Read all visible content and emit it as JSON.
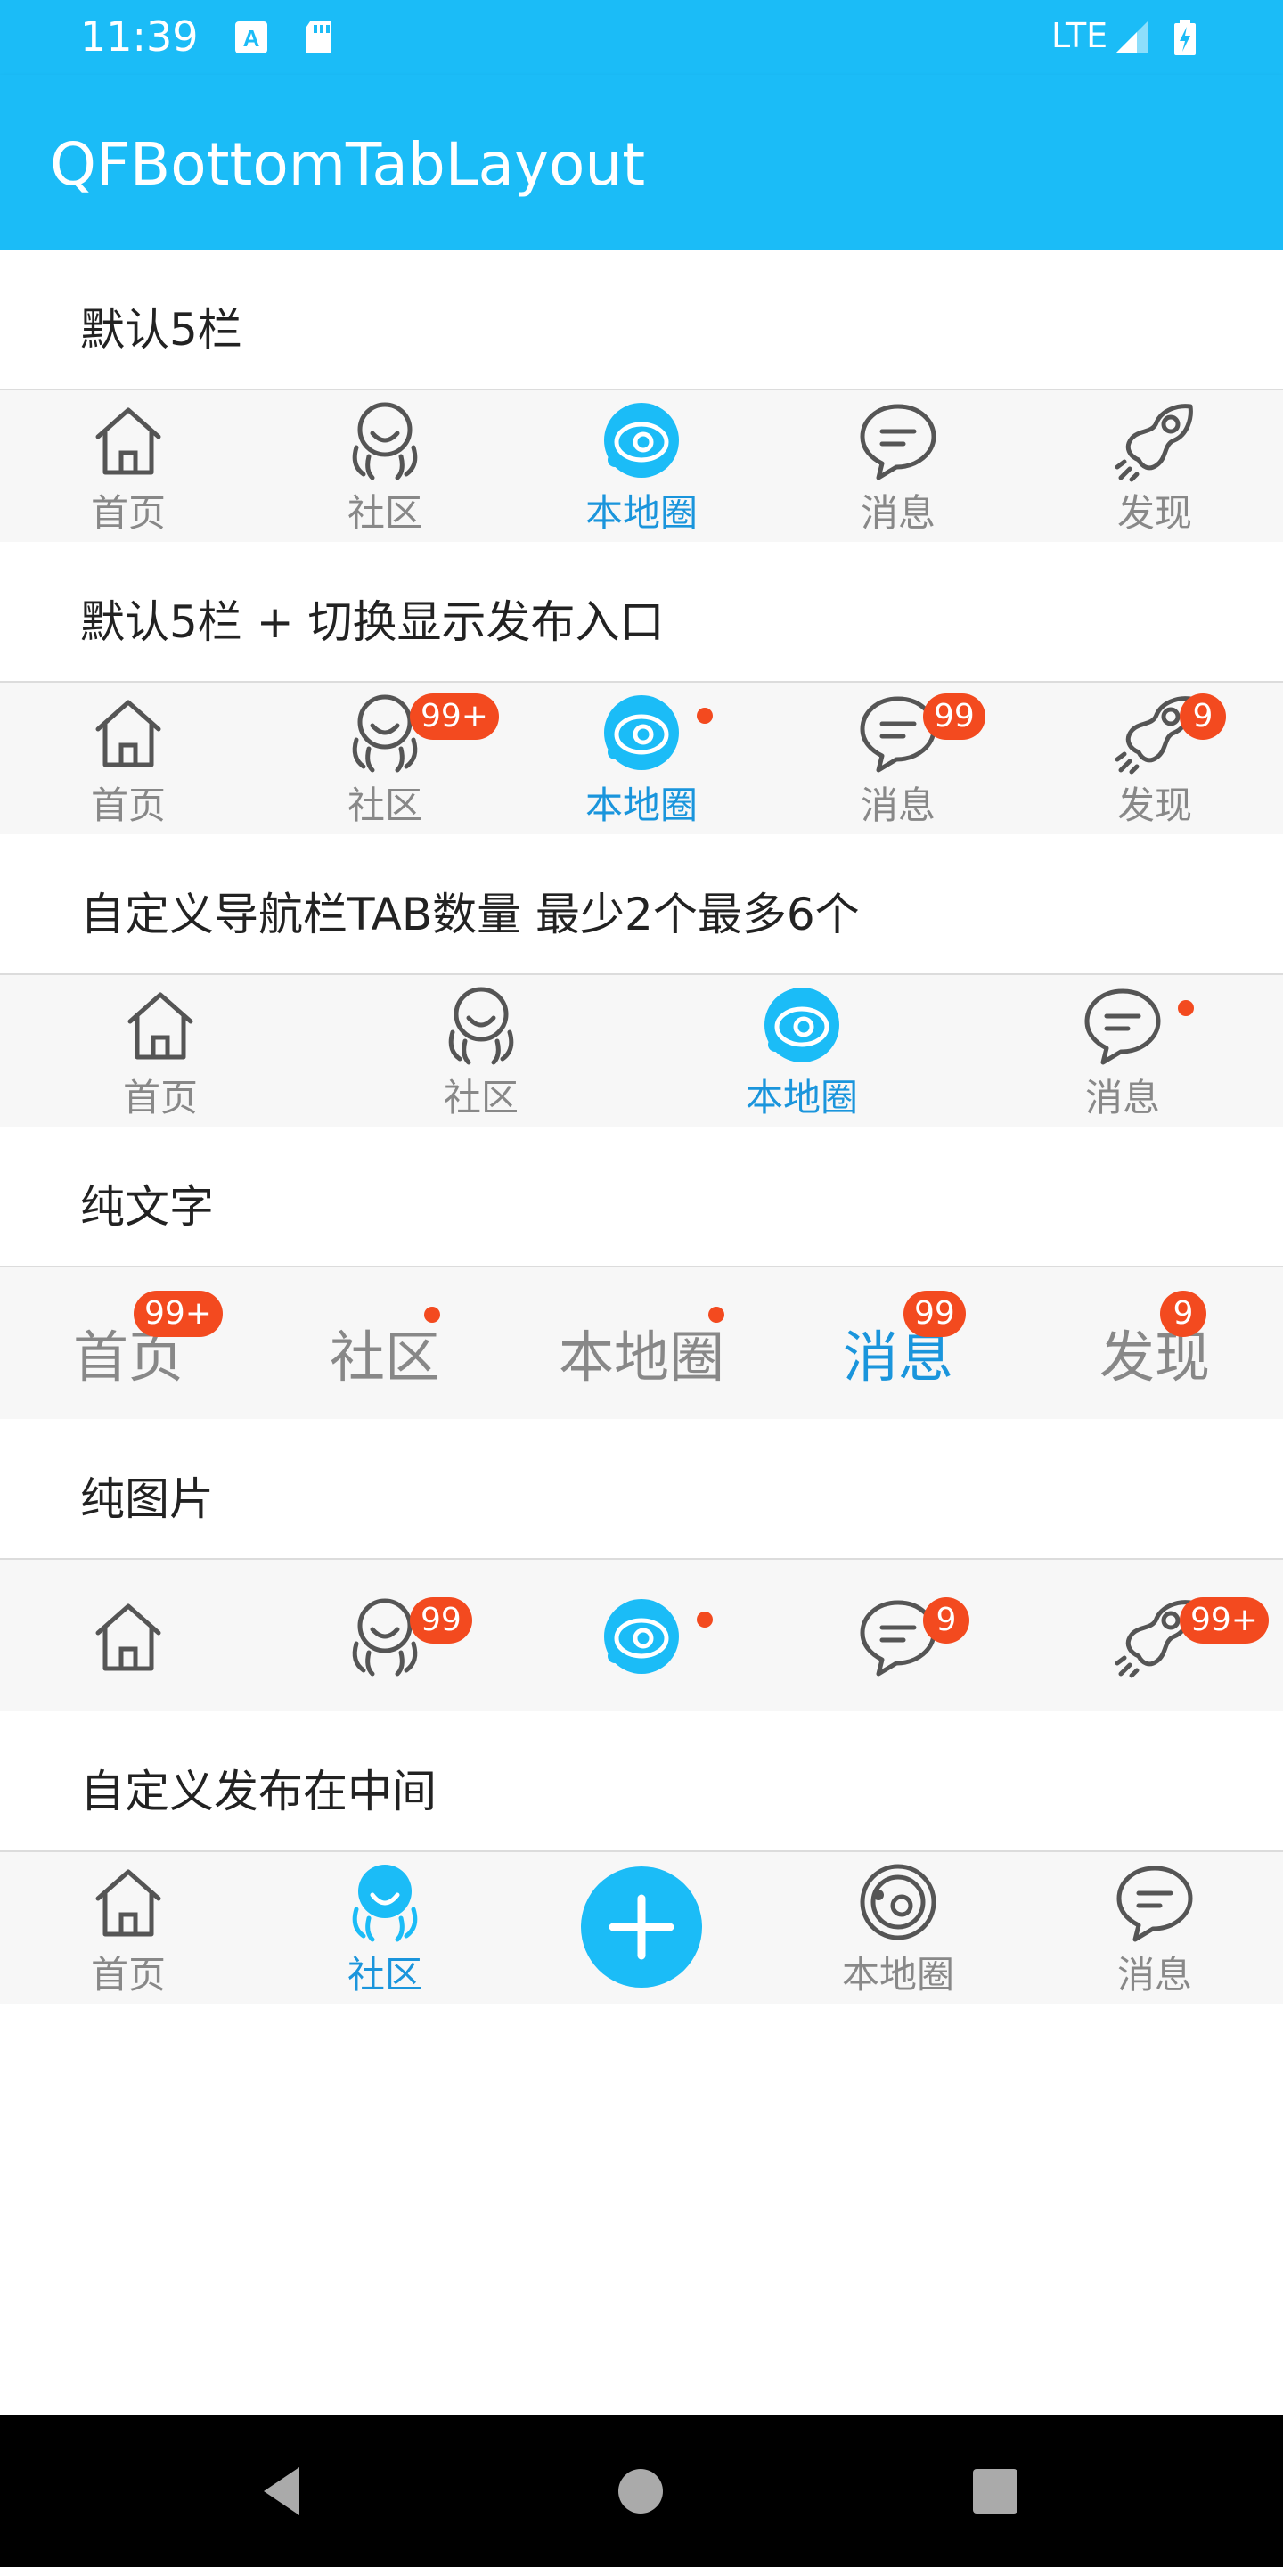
{
  "status_bar": {
    "time": "11:39",
    "network": "LTE"
  },
  "app_bar": {
    "title": "QFBottomTabLayout"
  },
  "sections": [
    "默认5栏",
    "默认5栏 + 切换显示发布入口",
    "自定义导航栏TAB数量 最少2个最多6个",
    "纯文字",
    "纯图片",
    "自定义发布在中间"
  ],
  "tabbar1": {
    "tabs": [
      {
        "label": "首页",
        "icon": "home-icon",
        "active": false
      },
      {
        "label": "社区",
        "icon": "community-icon",
        "active": false
      },
      {
        "label": "本地圈",
        "icon": "local-circle-icon",
        "active": true
      },
      {
        "label": "消息",
        "icon": "message-icon",
        "active": false
      },
      {
        "label": "发现",
        "icon": "rocket-icon",
        "active": false
      }
    ]
  },
  "tabbar2": {
    "tabs": [
      {
        "label": "首页",
        "icon": "home-icon",
        "active": false,
        "badge": ""
      },
      {
        "label": "社区",
        "icon": "community-icon",
        "active": false,
        "badge": "99+"
      },
      {
        "label": "本地圈",
        "icon": "local-circle-icon",
        "active": true,
        "badge": "dot"
      },
      {
        "label": "消息",
        "icon": "message-icon",
        "active": false,
        "badge": "99"
      },
      {
        "label": "发现",
        "icon": "rocket-icon",
        "active": false,
        "badge": "9"
      }
    ]
  },
  "tabbar3": {
    "tabs": [
      {
        "label": "首页",
        "icon": "home-icon",
        "active": false
      },
      {
        "label": "社区",
        "icon": "community-icon",
        "active": false
      },
      {
        "label": "本地圈",
        "icon": "local-circle-icon",
        "active": true
      },
      {
        "label": "消息",
        "icon": "message-icon",
        "active": false,
        "badge": "dot"
      }
    ]
  },
  "tabbar4": {
    "tabs": [
      {
        "label": "首页",
        "active": false,
        "badge": "99+"
      },
      {
        "label": "社区",
        "active": false,
        "badge": "dot"
      },
      {
        "label": "本地圈",
        "active": false,
        "badge": "dot"
      },
      {
        "label": "消息",
        "active": true,
        "badge": "99"
      },
      {
        "label": "发现",
        "active": false,
        "badge": "9"
      }
    ]
  },
  "tabbar5": {
    "tabs": [
      {
        "icon": "home-icon",
        "badge": ""
      },
      {
        "icon": "community-icon",
        "badge": "99"
      },
      {
        "icon": "local-circle-icon",
        "active": true,
        "badge": "dot"
      },
      {
        "icon": "message-icon",
        "badge": "9"
      },
      {
        "icon": "rocket-icon",
        "badge": "99+"
      }
    ]
  },
  "tabbar6": {
    "tabs": [
      {
        "label": "首页",
        "icon": "home-icon",
        "active": false
      },
      {
        "label": "社区",
        "icon": "community-icon",
        "active": true
      },
      {
        "label": "",
        "icon": "add-icon",
        "publish": true
      },
      {
        "label": "本地圈",
        "icon": "local-circle-icon",
        "active": false
      },
      {
        "label": "消息",
        "icon": "message-icon",
        "active": false
      }
    ]
  },
  "colors": {
    "accent": "#1bbcf7",
    "active_text": "#1a95dc",
    "badge": "#f34a1f",
    "inactive": "#888888"
  }
}
